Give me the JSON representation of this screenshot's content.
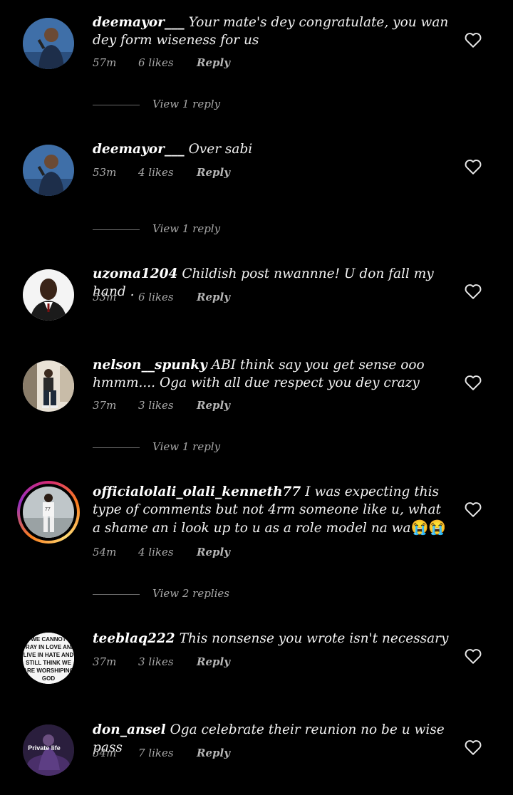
{
  "comments": [
    {
      "username": "deemayor___",
      "text": "Your mate's dey congratulate,  you wan dey form wiseness for us",
      "time": "57m",
      "likes": "6 likes",
      "reply": "Reply",
      "view_replies": "View 1 reply",
      "avatar_icon": "man-with-microphone-avatar"
    },
    {
      "username": "deemayor___",
      "text": "Over sabi",
      "time": "53m",
      "likes": "4 likes",
      "reply": "Reply",
      "view_replies": "View 1 reply",
      "avatar_icon": "man-with-microphone-avatar"
    },
    {
      "username": "uzoma1204",
      "text": "Childish post nwannne!  U don fall my hand .",
      "time": "53m",
      "likes": "6 likes",
      "reply": "Reply",
      "avatar_icon": "man-in-suit-avatar"
    },
    {
      "username": "nelson__spunky",
      "text": "ABI think say you get sense ooo hmmm.... Oga with all due respect you dey crazy",
      "time": "37m",
      "likes": "3 likes",
      "reply": "Reply",
      "view_replies": "View 1 reply",
      "avatar_icon": "seated-man-avatar"
    },
    {
      "username": "officialolali_olali_kenneth77",
      "text": "I was expecting this type of comments but not 4rm someone like u,  what a shame an i look up to u as a role model na wa",
      "emoji": "😭😭",
      "time": "54m",
      "likes": "4 likes",
      "reply": "Reply",
      "view_replies": "View 2 replies",
      "avatar_icon": "footballer-avatar"
    },
    {
      "username": "teeblaq222",
      "text": "This nonsense you wrote isn't necessary",
      "time": "37m",
      "likes": "3 likes",
      "reply": "Reply",
      "avatar_icon": "text-sign-avatar",
      "avatar_text": [
        "WE CANNOT",
        "PRAY IN LOVE AND",
        "LIVE IN HATE AND",
        "STILL THINK WE",
        "ARE WORSHIPING",
        "GOD"
      ]
    },
    {
      "username": "don_ansel",
      "text": "Oga celebrate their reunion no be u wise pass",
      "time": "54m",
      "likes": "7 likes",
      "reply": "Reply",
      "avatar_icon": "private-life-avatar",
      "avatar_text": [
        "Private life"
      ]
    }
  ]
}
